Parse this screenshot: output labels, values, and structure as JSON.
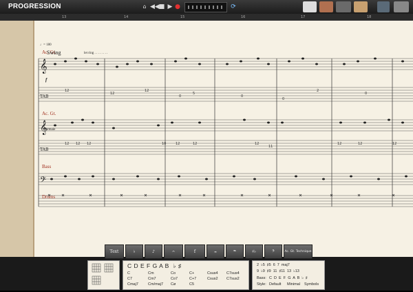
{
  "app": {
    "title": "PROGRESSION"
  },
  "transport": {
    "stop": "■",
    "play": "▶",
    "record": "●",
    "rewind": "◀◀",
    "loop": "⟳"
  },
  "ruler": {
    "bars": [
      "13",
      "14",
      "15",
      "16",
      "17",
      "18"
    ]
  },
  "score": {
    "tempo": "♩= 180",
    "swing": "Swing",
    "let_ring": "let ring . . . . . . . .",
    "normale": "normale",
    "dynamic": "f",
    "tracks": [
      {
        "name": "Ac. Gt."
      },
      {
        "name": "Ac. Gt."
      },
      {
        "name": "Bass"
      },
      {
        "name": "Drums"
      }
    ]
  },
  "tools": [
    {
      "label": "Text"
    },
    {
      "label": "♭"
    },
    {
      "label": "♪"
    },
    {
      "label": "𝄐"
    },
    {
      "label": "f"
    },
    {
      "label": "𝆗"
    },
    {
      "label": "𝆮"
    },
    {
      "label": "♯♭"
    },
    {
      "label": "𝄢"
    },
    {
      "label": "Ac. Gt. Technique"
    }
  ],
  "chord_panel": {
    "keys": "C D E F G A B  ♭ ♯",
    "columns": [
      [
        "C",
        "C7",
        "Cmaj7"
      ],
      [
        "Cm",
        "Cm7",
        "Cm/maj7"
      ],
      [
        "Co",
        "Co7",
        "Cø"
      ],
      [
        "C+",
        "C+7",
        "C5"
      ],
      [
        "Csus4",
        "Csus2",
        ""
      ],
      [
        "C7sus4",
        "C7sus2",
        ""
      ]
    ]
  },
  "extensions_panel": {
    "row1": "2  ♭5  ♯5  6  7  maj7",
    "row2": "9  ♭9  ♯9  11  ♯11  13  ♭13",
    "bass_label": "Bass:",
    "bass_notes": "C  D  E  F  G  A  B  ♭  ♯",
    "style_label": "Style:",
    "style_options": [
      "Default",
      "Minimal",
      "Symbols"
    ]
  }
}
